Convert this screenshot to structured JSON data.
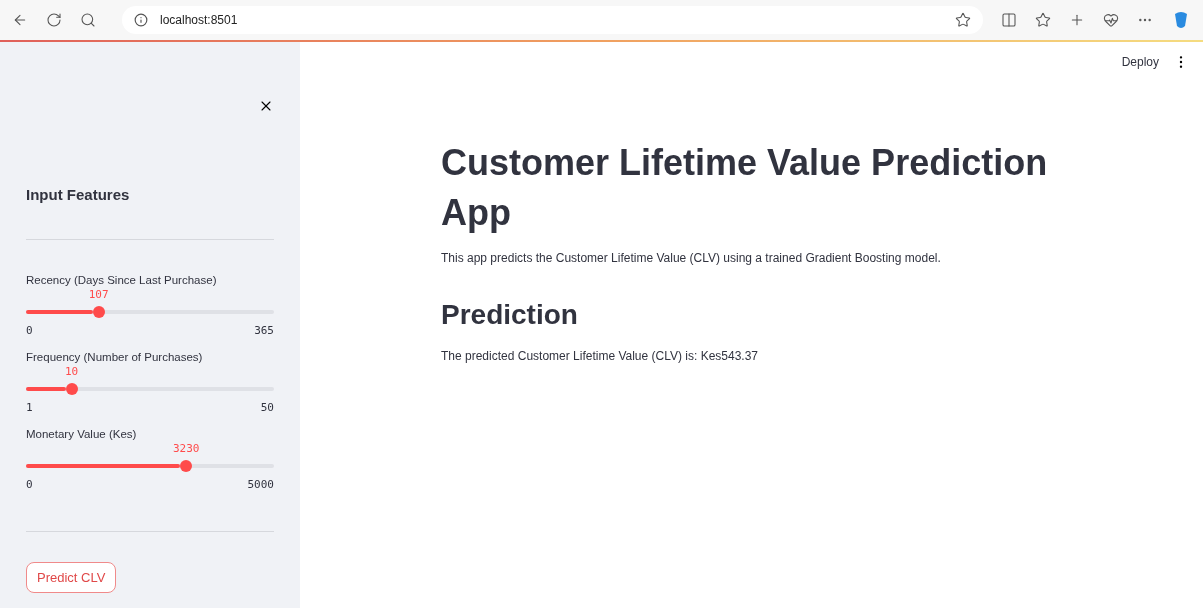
{
  "browser": {
    "url": "localhost:8501"
  },
  "sidebar": {
    "title": "Input Features",
    "sliders": [
      {
        "label": "Recency (Days Since Last Purchase)",
        "value": "107",
        "min": "0",
        "max": "365",
        "level": 0.293
      },
      {
        "label": "Frequency (Number of Purchases)",
        "value": "10",
        "min": "1",
        "max": "50",
        "level": 0.184
      },
      {
        "label": "Monetary Value (Kes)",
        "value": "3230",
        "min": "0",
        "max": "5000",
        "level": 0.646
      }
    ],
    "button": "Predict CLV"
  },
  "header": {
    "deploy": "Deploy"
  },
  "main": {
    "title": "Customer Lifetime Value Prediction App",
    "description": "This app predicts the Customer Lifetime Value (CLV) using a trained Gradient Boosting model.",
    "heading": "Prediction",
    "result": "The predicted Customer Lifetime Value (CLV) is: Kes543.37"
  }
}
